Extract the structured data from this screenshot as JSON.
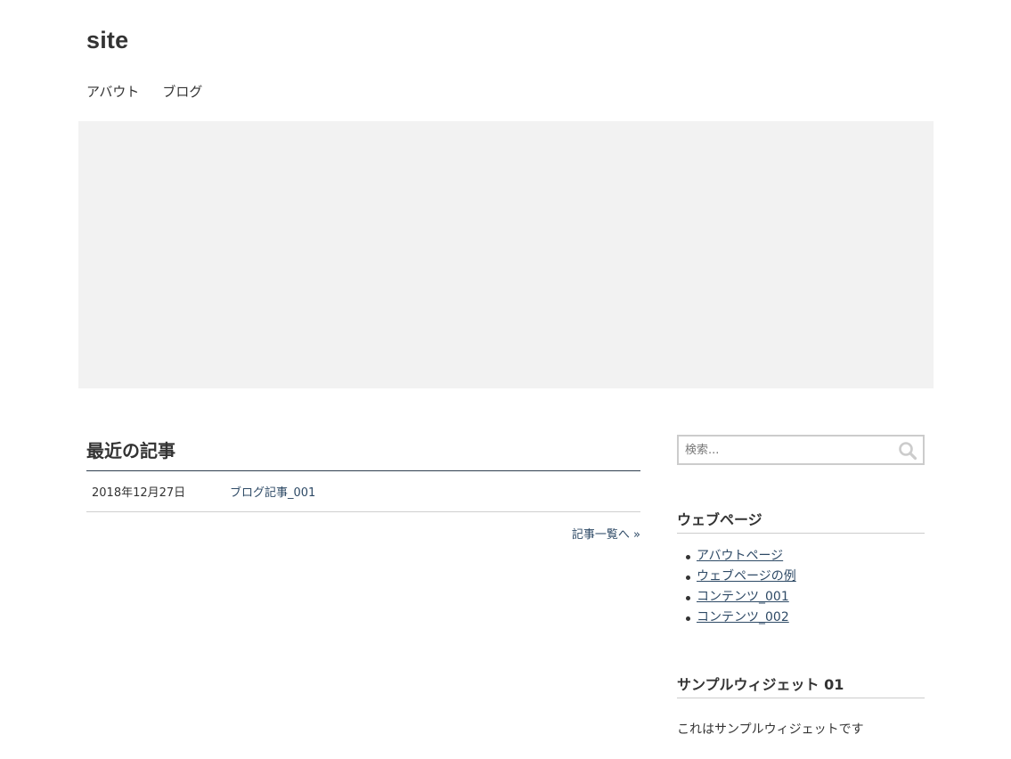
{
  "site": {
    "title": "site"
  },
  "nav": {
    "items": [
      {
        "label": "アバウト"
      },
      {
        "label": "ブログ"
      }
    ]
  },
  "recent_posts": {
    "title": "最近の記事",
    "posts": [
      {
        "date": "2018年12月27日",
        "title": "ブログ記事_001"
      }
    ],
    "more_label": "記事一覧へ »"
  },
  "sidebar": {
    "search": {
      "placeholder": "検索..."
    },
    "pages_widget": {
      "title": "ウェブページ",
      "items": [
        {
          "label": "アバウトページ"
        },
        {
          "label": "ウェブページの例"
        },
        {
          "label": "コンテンツ_001"
        },
        {
          "label": "コンテンツ_002"
        }
      ]
    },
    "sample_widget": {
      "title": "サンプルウィジェット 01",
      "text": "これはサンプルウィジェットです"
    }
  },
  "colors": {
    "link": "#2e4a66",
    "hero_bg": "#f2f2f2",
    "text": "#333333"
  }
}
